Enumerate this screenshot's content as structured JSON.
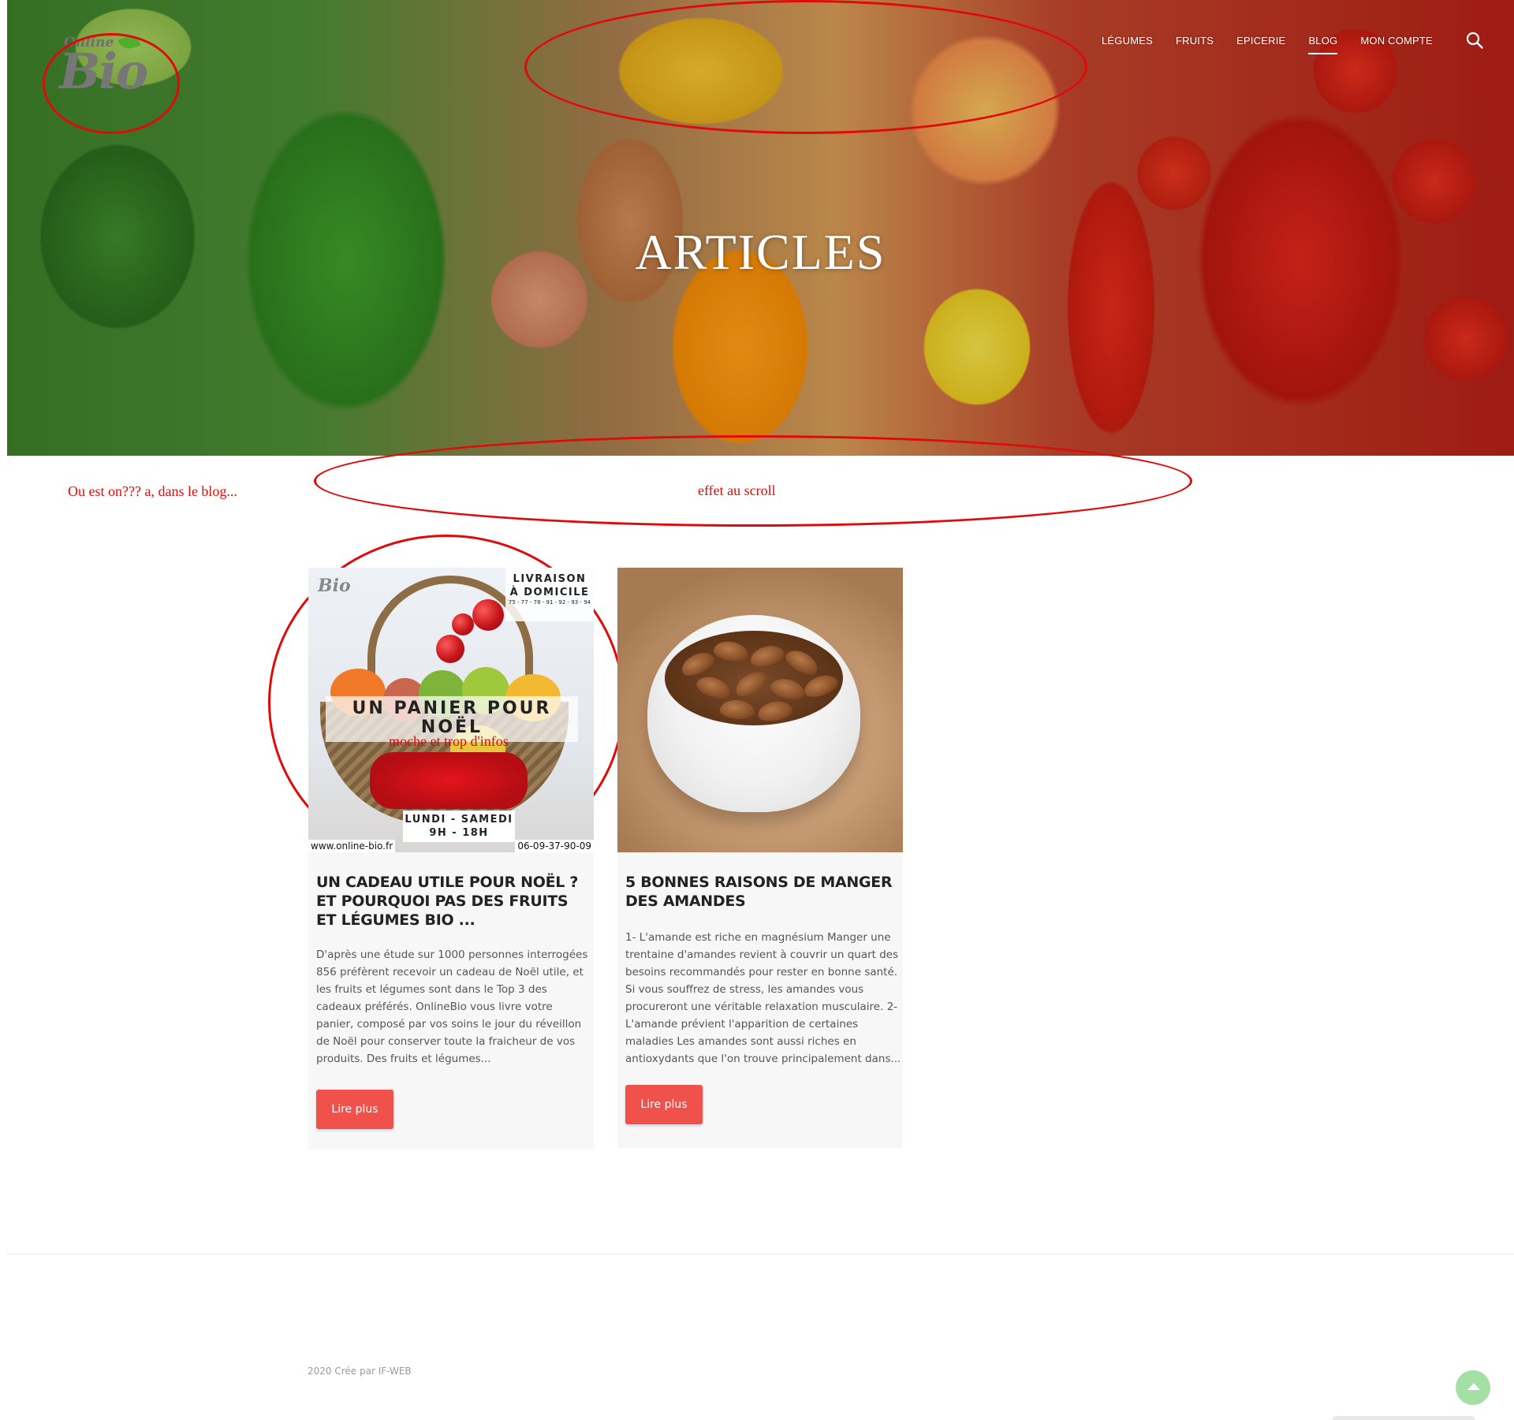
{
  "header": {
    "logo_small": "Online",
    "logo_big": "Bio",
    "nav": [
      {
        "label": "Légumes"
      },
      {
        "label": "Fruits"
      },
      {
        "label": "Epicerie"
      },
      {
        "label": "Blog"
      },
      {
        "label": "Mon compte"
      }
    ],
    "active_nav": "Blog",
    "search_icon": "search-icon"
  },
  "hero": {
    "title": "ARTICLES"
  },
  "annotations": {
    "breadcrumb_note": "Ou est on??? a, dans le blog...",
    "scroll_note": "effet au scroll",
    "image_note": "moche et trop d'infos",
    "color": "#e00a0a"
  },
  "articles": [
    {
      "title": "UN CADEAU UTILE POUR NOËL ? ET POURQUOI PAS DES FRUITS ET LÉGUMES BIO ...",
      "excerpt": "D'après une étude sur 1000 personnes interrogées 856 préfèrent recevoir un cadeau de Noël utile, et les fruits et légumes sont dans le Top 3 des cadeaux préférés. OnlineBio vous livre votre panier, composé par vos soins le jour du réveillon de Noël pour conserver toute la fraicheur de vos produits. Des fruits et légumes...",
      "button": "Lire plus",
      "image": {
        "mini_logo": "Bio",
        "badge_line1": "LIVRAISON",
        "badge_line2": "À DOMICILE",
        "badge_tel": "75 - 77 - 78 - 91 - 92 - 93 - 94",
        "banner": "UN PANIER POUR NOËL",
        "hours_line1": "LUNDI - SAMEDI",
        "hours_line2": "9H - 18H",
        "url": "www.online-bio.fr",
        "phone": "06-09-37-90-09"
      }
    },
    {
      "title": "5 BONNES RAISONS DE MANGER DES AMANDES",
      "excerpt": "1- L'amande est riche en magnésium Manger une trentaine d'amandes revient à couvrir un quart des besoins recommandés pour rester en bonne santé. Si vous souffrez de stress, les amandes vous procureront une véritable relaxation musculaire. 2- L'amande prévient l'apparition de certaines maladies Les amandes sont aussi riches en antioxydants que l'on trouve principalement dans...",
      "button": "Lire plus"
    }
  ],
  "footer": {
    "copyright": "2020 Crée par IF-WEB"
  },
  "colors": {
    "button": "#f0514a",
    "scroll_top": "#a4e0a4"
  }
}
